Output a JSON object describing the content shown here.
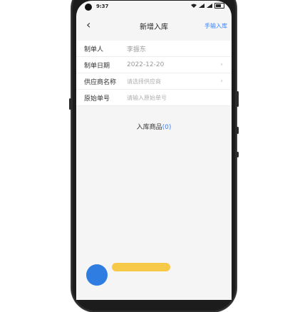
{
  "status_bar": {
    "time": "9:37",
    "icons_left": "",
    "icons_right": [
      "wifi-icon",
      "signal-icon",
      "signal-icon",
      "battery-icon"
    ]
  },
  "nav": {
    "back_icon": "chevron-left-icon",
    "title": "新增入库",
    "action_label": "手输入库"
  },
  "form": {
    "rows": [
      {
        "label": "制单人",
        "value": "李振东",
        "placeholder": "",
        "has_chevron": false
      },
      {
        "label": "制单日期",
        "value": "2022-12-20",
        "placeholder": "",
        "has_chevron": true
      },
      {
        "label": "供应商名称",
        "value": "",
        "placeholder": "请选择供应商",
        "has_chevron": true
      },
      {
        "label": "原始单号",
        "value": "",
        "placeholder": "请输入原始单号",
        "has_chevron": false
      }
    ]
  },
  "goods": {
    "label": "入库商品",
    "count_text": "(0)"
  },
  "bottom": {
    "tip_text": ""
  },
  "colors": {
    "accent": "#3b82f6",
    "background": "#f5f5f5",
    "fab": "#2f7de1",
    "tip": "#f7c948"
  }
}
